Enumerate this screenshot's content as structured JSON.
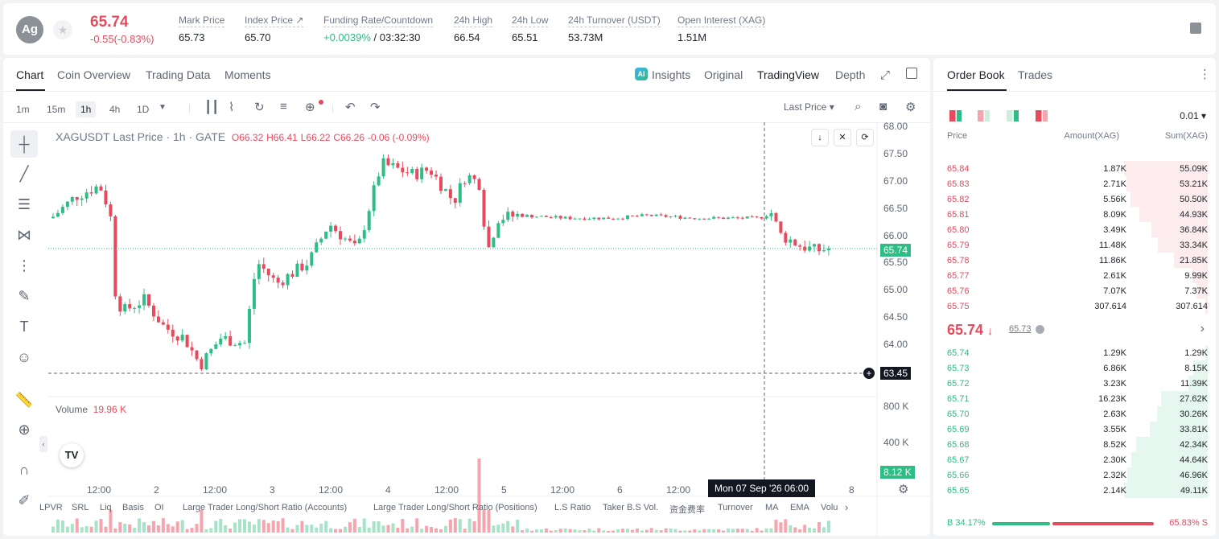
{
  "header": {
    "symbol_initials": "Ag",
    "price": "65.74",
    "change": "-0.55(-0.83%)",
    "stats": [
      {
        "label": "Mark Price",
        "value": "65.73"
      },
      {
        "label": "Index Price ↗",
        "value": "65.70"
      },
      {
        "label": "Funding Rate/Countdown",
        "value": "+0.0039%",
        "value2": " / 03:32:30"
      },
      {
        "label": "24h High",
        "value": "66.54"
      },
      {
        "label": "24h Low",
        "value": "65.51"
      },
      {
        "label": "24h Turnover (USDT)",
        "value": "53.73M"
      },
      {
        "label": "Open Interest (XAG)",
        "value": "1.51M"
      }
    ]
  },
  "chart_tabs": [
    "Chart",
    "Coin Overview",
    "Trading Data",
    "Moments"
  ],
  "view_tabs": [
    "Insights",
    "Original",
    "TradingView",
    "Depth"
  ],
  "timeframes": [
    "1m",
    "15m",
    "1h",
    "4h",
    "1D"
  ],
  "price_type": "Last Price",
  "legend": {
    "title": "XAGUSDT Last Price · 1h · GATE",
    "o": "O66.32",
    "h": "H66.41",
    "l": "L66.22",
    "c": "C66.26",
    "chg": "-0.06 (-0.09%)"
  },
  "y_axis": [
    "68.00",
    "67.50",
    "67.00",
    "66.50",
    "66.00",
    "65.50",
    "65.00",
    "64.50",
    "64.00"
  ],
  "price_tag": "65.74",
  "crosshair_tag": "63.45",
  "volume": {
    "label": "Volume",
    "value": "19.96 K",
    "axis": [
      "800 K",
      "400 K"
    ],
    "tag": "8.12 K"
  },
  "x_axis": [
    "12:00",
    "2",
    "12:00",
    "3",
    "12:00",
    "4",
    "12:00",
    "5",
    "12:00",
    "6",
    "12:00",
    "8"
  ],
  "crosshair_time": "Mon 07 Sep '26   06:00",
  "indicators": [
    "LPVR",
    "SRL",
    "Liq",
    "Basis",
    "OI",
    "Large Trader Long/Short Ratio (Accounts)",
    "Large Trader Long/Short Ratio (Positions)",
    "L.S Ratio",
    "Taker B.S Vol.",
    "资金费率",
    "Turnover",
    "MA",
    "EMA",
    "Volu"
  ],
  "orderbook": {
    "tabs": [
      "Order Book",
      "Trades"
    ],
    "precision": "0.01",
    "headers": [
      "Price",
      "Amount(XAG)",
      "Sum(XAG)"
    ],
    "asks": [
      [
        "65.84",
        "1.87K",
        "55.09K",
        1.0
      ],
      [
        "65.83",
        "2.71K",
        "53.21K",
        0.97
      ],
      [
        "65.82",
        "5.56K",
        "50.50K",
        0.92
      ],
      [
        "65.81",
        "8.09K",
        "44.93K",
        0.82
      ],
      [
        "65.80",
        "3.49K",
        "36.84K",
        0.67
      ],
      [
        "65.79",
        "11.48K",
        "33.34K",
        0.6
      ],
      [
        "65.78",
        "11.86K",
        "21.85K",
        0.4
      ],
      [
        "65.77",
        "2.61K",
        "9.99K",
        0.18
      ],
      [
        "65.76",
        "7.07K",
        "7.37K",
        0.13
      ],
      [
        "65.75",
        "307.614",
        "307.614",
        0.01
      ]
    ],
    "mid_price": "65.74",
    "mid_mark": "65.73",
    "bids": [
      [
        "65.74",
        "1.29K",
        "1.29K",
        0.03
      ],
      [
        "65.73",
        "6.86K",
        "8.15K",
        0.17
      ],
      [
        "65.72",
        "3.23K",
        "11.39K",
        0.23
      ],
      [
        "65.71",
        "16.23K",
        "27.62K",
        0.56
      ],
      [
        "65.70",
        "2.63K",
        "30.26K",
        0.61
      ],
      [
        "65.69",
        "3.55K",
        "33.81K",
        0.69
      ],
      [
        "65.68",
        "8.52K",
        "42.34K",
        0.86
      ],
      [
        "65.67",
        "2.30K",
        "44.64K",
        0.91
      ],
      [
        "65.66",
        "2.32K",
        "46.96K",
        0.96
      ],
      [
        "65.65",
        "2.14K",
        "49.11K",
        1.0
      ]
    ],
    "buy_ratio": "B 34.17%",
    "sell_ratio": "65.83% S"
  },
  "colors": {
    "up": "#2ebd85",
    "down": "#e74a5c"
  }
}
